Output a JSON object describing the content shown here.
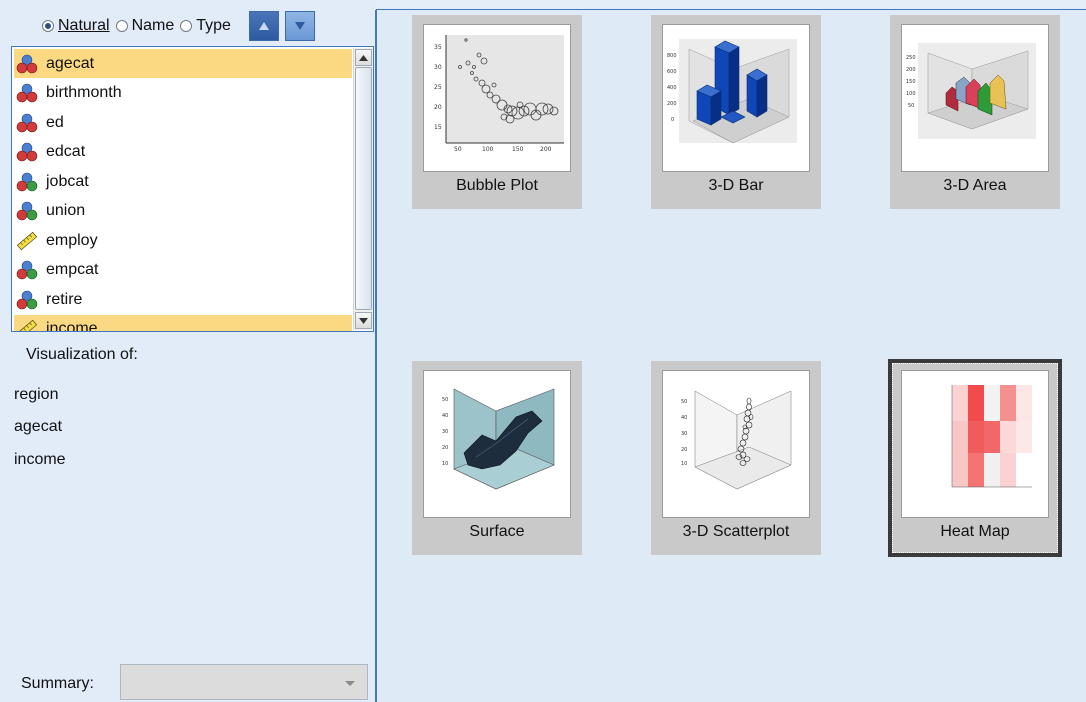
{
  "sort": {
    "options": [
      {
        "label": "Natural",
        "selected": true
      },
      {
        "label": "Name",
        "selected": false
      },
      {
        "label": "Type",
        "selected": false
      }
    ]
  },
  "variables": [
    {
      "name": "agecat",
      "icon": "nominal-icon",
      "selected": true
    },
    {
      "name": "birthmonth",
      "icon": "nominal-icon",
      "selected": false
    },
    {
      "name": "ed",
      "icon": "nominal-icon",
      "selected": false
    },
    {
      "name": "edcat",
      "icon": "nominal-icon",
      "selected": false
    },
    {
      "name": "jobcat",
      "icon": "ordinal-icon",
      "selected": false
    },
    {
      "name": "union",
      "icon": "ordinal-icon",
      "selected": false
    },
    {
      "name": "employ",
      "icon": "scale-ruler-icon",
      "selected": false
    },
    {
      "name": "empcat",
      "icon": "ordinal-icon",
      "selected": false
    },
    {
      "name": "retire",
      "icon": "ordinal-icon",
      "selected": false
    },
    {
      "name": "income",
      "icon": "scale-ruler-icon",
      "selected": true
    }
  ],
  "visualization": {
    "label": "Visualization of:",
    "items": [
      "region",
      "agecat",
      "income"
    ]
  },
  "summary": {
    "label": "Summary:",
    "value": ""
  },
  "charts": [
    {
      "label": "Bubble Plot",
      "icon": "bubble-plot-thumbnail",
      "selected": false
    },
    {
      "label": "3-D Bar",
      "icon": "3d-bar-thumbnail",
      "selected": false
    },
    {
      "label": "3-D Area",
      "icon": "3d-area-thumbnail",
      "selected": false
    },
    {
      "label": "Surface",
      "icon": "surface-thumbnail",
      "selected": false
    },
    {
      "label": "3-D Scatterplot",
      "icon": "3d-scatterplot-thumbnail",
      "selected": false
    },
    {
      "label": "Heat Map",
      "icon": "heat-map-thumbnail",
      "selected": true
    }
  ],
  "colors": {
    "selection": "#fbd982",
    "accent": "#3e77c2",
    "card": "#c9c9c9"
  }
}
